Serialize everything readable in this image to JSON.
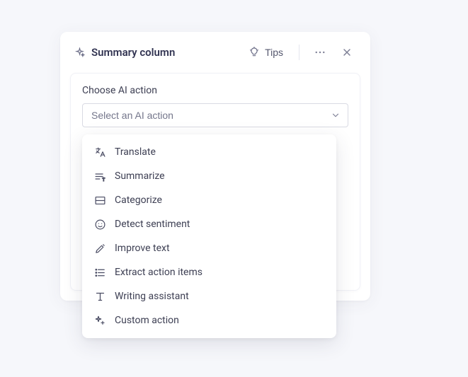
{
  "panel": {
    "title": "Summary column",
    "tips_label": "Tips"
  },
  "field": {
    "label": "Choose AI action",
    "placeholder": "Select an AI action"
  },
  "options": [
    {
      "label": "Translate"
    },
    {
      "label": "Summarize"
    },
    {
      "label": "Categorize"
    },
    {
      "label": "Detect sentiment"
    },
    {
      "label": "Improve text"
    },
    {
      "label": "Extract action items"
    },
    {
      "label": "Writing assistant"
    },
    {
      "label": "Custom action"
    }
  ]
}
